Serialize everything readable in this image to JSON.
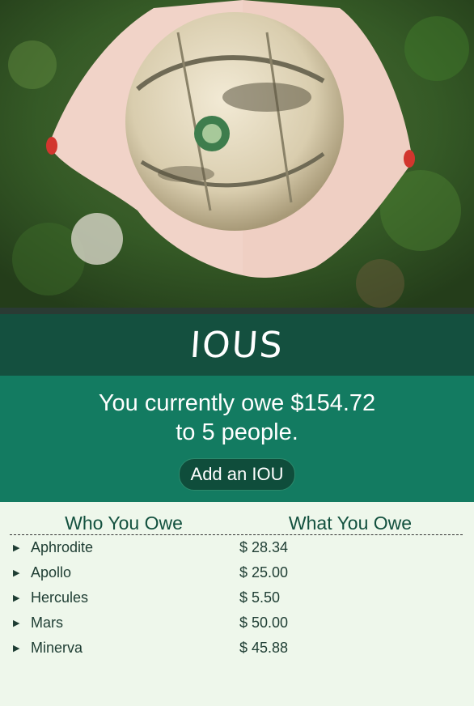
{
  "header": {
    "title": "IOUS"
  },
  "summary": {
    "line1": "You currently owe $154.72",
    "line2": "to 5 people.",
    "add_button": "Add an IOU"
  },
  "table": {
    "headers": [
      "Who You Owe",
      "What You Owe"
    ],
    "rows": [
      {
        "name": "Aphrodite",
        "amount": "$ 28.34"
      },
      {
        "name": "Apollo",
        "amount": "$ 25.00"
      },
      {
        "name": "Hercules",
        "amount": "$ 5.50"
      },
      {
        "name": "Mars",
        "amount": "$ 50.00"
      },
      {
        "name": "Minerva",
        "amount": "$ 45.88"
      }
    ]
  },
  "colors": {
    "title_band": "#14503f",
    "summary_band": "#137b61",
    "list_bg": "#eef7eb",
    "text_dark": "#13513f"
  },
  "icons": {
    "row_toggle": "triangle-right-icon"
  }
}
